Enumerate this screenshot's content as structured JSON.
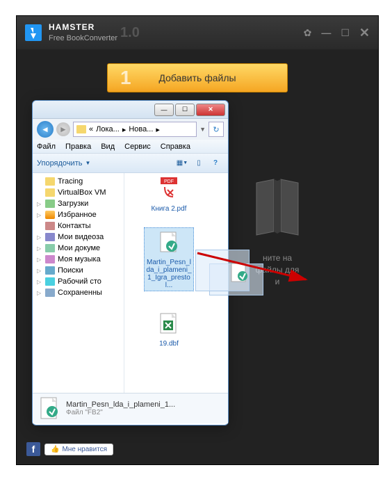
{
  "app": {
    "name": "HAMSTER",
    "subtitle": "Free BookConverter",
    "version": "1.0"
  },
  "add_button": {
    "number": "1",
    "label": "Добавить файлы"
  },
  "drop": {
    "line1": "ните на",
    "line2": "файлы для",
    "line3": "и"
  },
  "like_button": "Мне нравится",
  "explorer": {
    "breadcrumb": {
      "part1": "Лока...",
      "part2": "Нова..."
    },
    "menu": {
      "file": "Файл",
      "edit": "Правка",
      "view": "Вид",
      "service": "Сервис",
      "help": "Справка"
    },
    "toolbar": {
      "organize": "Упорядочить"
    },
    "tree": [
      "Tracing",
      "VirtualBox VM",
      "Загрузки",
      "Избранное",
      "Контакты",
      "Мои видеоза",
      "Мои докуме",
      "Моя музыка",
      "Поиски",
      "Рабочий сто",
      "Сохраненны"
    ],
    "files": {
      "pdf": {
        "name": "Книга 2.pdf",
        "badge": "PDF"
      },
      "fb2": {
        "name": "Martin_Pesn_lda_i_plameni_1_Igra_prestol..."
      },
      "dbf": {
        "name": "19.dbf"
      }
    },
    "status": {
      "filename": "Martin_Pesn_lda_i_plameni_1...",
      "filetype": "Файл \"FB2\""
    }
  }
}
